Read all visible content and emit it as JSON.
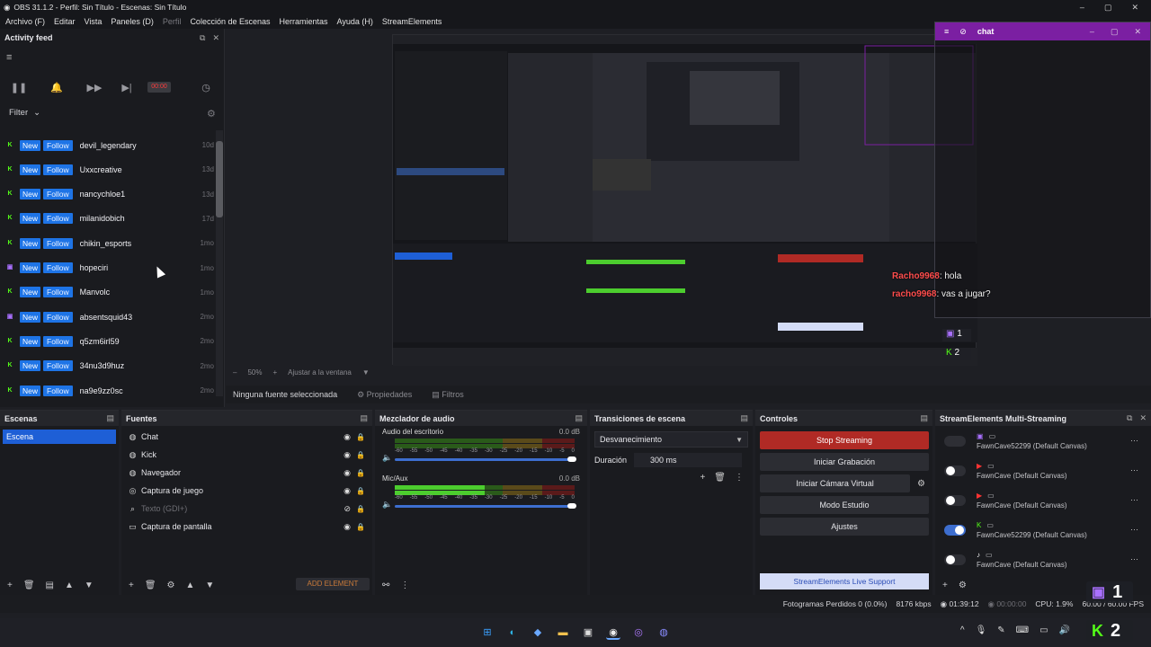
{
  "titlebar": {
    "title": "OBS 31.1.2 - Perfil: Sin Título - Escenas: Sin Título"
  },
  "menubar": {
    "items": [
      "Archivo (F)",
      "Editar",
      "Vista",
      "Paneles (D)",
      "Perfil",
      "Colección de Escenas",
      "Herramientas",
      "Ayuda (H)",
      "StreamElements"
    ]
  },
  "activity": {
    "title": "Activity feed",
    "timer": "00:00",
    "filter_label": "Filter",
    "rows": [
      {
        "platform": "kick",
        "type": "New",
        "action": "Follow",
        "user": "devil_legendary",
        "age": "10d"
      },
      {
        "platform": "kick",
        "type": "New",
        "action": "Follow",
        "user": "Uxxcreative",
        "age": "13d"
      },
      {
        "platform": "kick",
        "type": "New",
        "action": "Follow",
        "user": "nancychloe1",
        "age": "13d"
      },
      {
        "platform": "kick",
        "type": "New",
        "action": "Follow",
        "user": "milanidobich",
        "age": "17d"
      },
      {
        "platform": "kick",
        "type": "New",
        "action": "Follow",
        "user": "chikin_esports",
        "age": "1mo"
      },
      {
        "platform": "twitch",
        "type": "New",
        "action": "Follow",
        "user": "hopeciri",
        "age": "1mo"
      },
      {
        "platform": "kick",
        "type": "New",
        "action": "Follow",
        "user": "Manvolc",
        "age": "1mo"
      },
      {
        "platform": "twitch",
        "type": "New",
        "action": "Follow",
        "user": "absentsquid43",
        "age": "2mo"
      },
      {
        "platform": "kick",
        "type": "New",
        "action": "Follow",
        "user": "q5zm6irl59",
        "age": "2mo"
      },
      {
        "platform": "kick",
        "type": "New",
        "action": "Follow",
        "user": "34nu3d9huz",
        "age": "2mo"
      },
      {
        "platform": "kick",
        "type": "New",
        "action": "Follow",
        "user": "na9e9zz0sc",
        "age": "2mo"
      }
    ]
  },
  "chat": {
    "title": "chat",
    "messages": [
      {
        "nick": "Racho9968",
        "text": ": hola"
      },
      {
        "nick": "racho9968",
        "text": ": vas a jugar?"
      }
    ]
  },
  "preview": {
    "zoom": "50%",
    "fit_label": "Ajustar a la ventana"
  },
  "srcbar": {
    "no_source": "Ninguna fuente seleccionada",
    "properties": "Propiedades",
    "filters": "Filtros"
  },
  "scenes": {
    "title": "Escenas",
    "items": [
      "Escena"
    ]
  },
  "sources": {
    "title": "Fuentes",
    "items": [
      {
        "name": "Chat",
        "icon": "globe-icon",
        "dim": false
      },
      {
        "name": "Kick",
        "icon": "globe-icon",
        "dim": false
      },
      {
        "name": "Navegador",
        "icon": "globe-icon",
        "dim": false
      },
      {
        "name": "Captura de juego",
        "icon": "gamepad-icon",
        "dim": false
      },
      {
        "name": "Texto (GDI+)",
        "icon": "text-icon",
        "dim": true
      },
      {
        "name": "Captura de pantalla",
        "icon": "monitor-icon",
        "dim": false
      }
    ],
    "add_element": "ADD ELEMENT"
  },
  "mixer": {
    "title": "Mezclador de audio",
    "channels": [
      {
        "name": "Audio del escritorio",
        "db": "0.0 dB",
        "level": 0.0
      },
      {
        "name": "Mic/Aux",
        "db": "0.0 dB",
        "level": 0.5
      }
    ],
    "ticks": [
      "-60",
      "-55",
      "-50",
      "-45",
      "-40",
      "-35",
      "-30",
      "-25",
      "-20",
      "-15",
      "-10",
      "-5",
      "0"
    ]
  },
  "transitions": {
    "title": "Transiciones de escena",
    "selected": "Desvanecimiento",
    "duration_label": "Duración",
    "duration_value": "300 ms"
  },
  "controls": {
    "title": "Controles",
    "buttons": [
      "Stop Streaming",
      "Iniciar Grabación",
      "Iniciar Cámara Virtual",
      "Modo Estudio",
      "Ajustes"
    ],
    "support": "StreamElements Live Support"
  },
  "multistream": {
    "title": "StreamElements Multi-Streaming",
    "rows": [
      {
        "on": false,
        "label": "FawnCave52299 (Default Canvas)"
      },
      {
        "on": false,
        "label": "FawnCave (Default Canvas)"
      },
      {
        "on": false,
        "label": "FawnCave (Default Canvas)"
      },
      {
        "on": true,
        "label": "FawnCave52299 (Default Canvas)"
      },
      {
        "on": false,
        "label": "FawnCave (Default Canvas)"
      }
    ]
  },
  "status": {
    "dropped": "Fotogramas Perdidos 0 (0.0%)",
    "kbps": "8176 kbps",
    "live_time": "01:39:12",
    "rec_time": "00:00:00",
    "cpu": "CPU: 1.9%",
    "fps": "60.00 / 60.00 FPS"
  },
  "badges": {
    "twitch": "1",
    "kick": "2"
  },
  "colors": {
    "accent": "#1e74e6",
    "stop": "#b02a25",
    "chat": "#7b1fa2",
    "kick": "#53fc18",
    "twitch": "#a970ff"
  }
}
